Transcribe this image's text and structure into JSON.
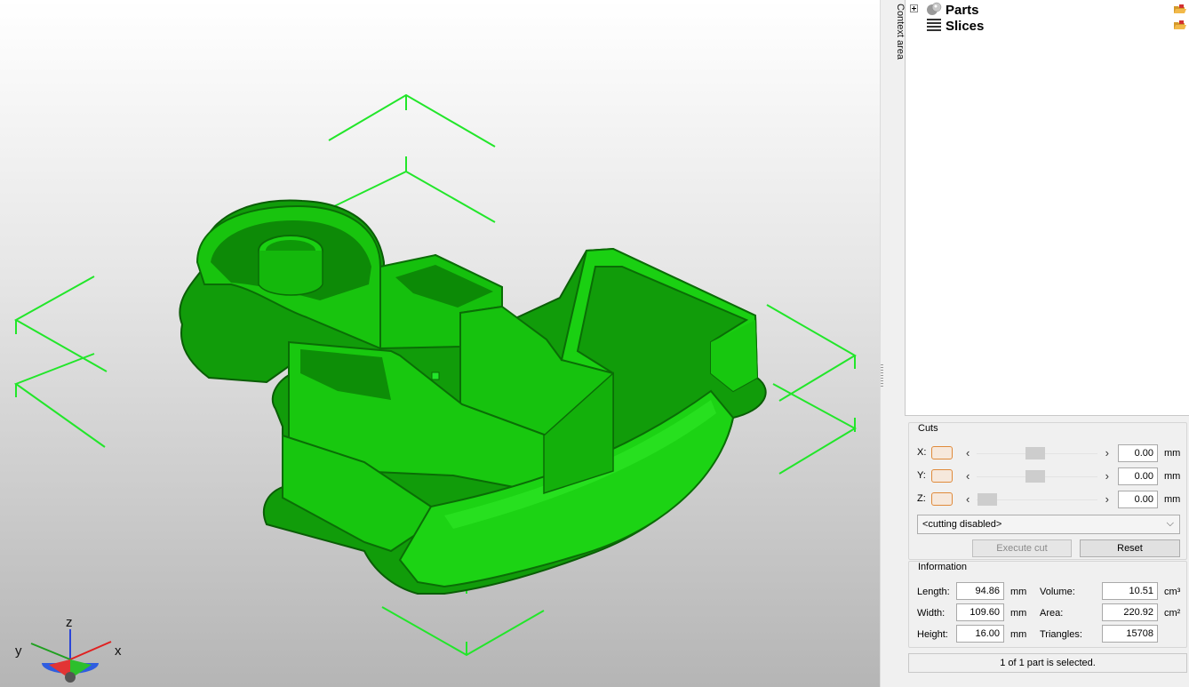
{
  "viewport": {
    "model_color": "#12b00b",
    "bbox_color": "#22e62a",
    "axis_labels": {
      "x": "x",
      "y": "y",
      "z": "z"
    }
  },
  "context_area": {
    "label": "Context area"
  },
  "tree": {
    "items": [
      {
        "label": "Parts",
        "icon": "parts-spheres-icon",
        "expandable": true
      },
      {
        "label": "Slices",
        "icon": "slices-stack-icon",
        "expandable": false
      }
    ]
  },
  "cuts": {
    "title": "Cuts",
    "rows": [
      {
        "axis": "X:",
        "value": "0.00",
        "unit": "mm",
        "thumb_fraction": 0.5
      },
      {
        "axis": "Y:",
        "value": "0.00",
        "unit": "mm",
        "thumb_fraction": 0.5
      },
      {
        "axis": "Z:",
        "value": "0.00",
        "unit": "mm",
        "thumb_fraction": 0.0
      }
    ],
    "mode_select": "<cutting disabled>",
    "execute_label": "Execute cut",
    "reset_label": "Reset"
  },
  "info": {
    "title": "Information",
    "length_label": "Length:",
    "length_value": "94.86",
    "length_unit": "mm",
    "width_label": "Width:",
    "width_value": "109.60",
    "width_unit": "mm",
    "height_label": "Height:",
    "height_value": "16.00",
    "height_unit": "mm",
    "volume_label": "Volume:",
    "volume_value": "10.51",
    "volume_unit": "cm³",
    "area_label": "Area:",
    "area_value": "220.92",
    "area_unit": "cm²",
    "triangles_label": "Triangles:",
    "triangles_value": "15708"
  },
  "status": {
    "text": "1 of 1 part is selected."
  }
}
